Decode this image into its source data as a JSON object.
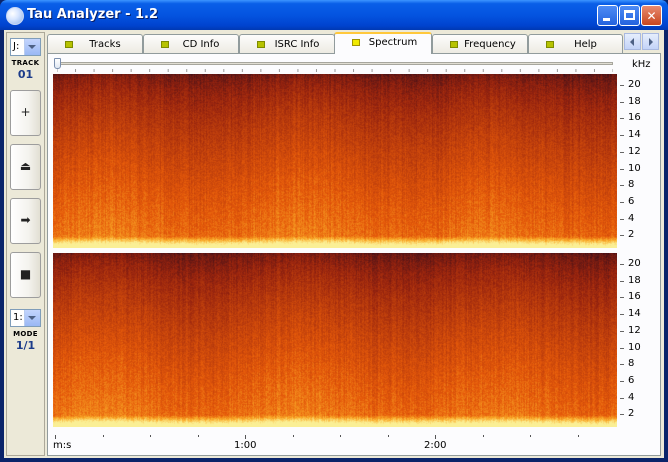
{
  "window": {
    "title": "Tau Analyzer - 1.2",
    "accent": "#0454e0"
  },
  "sidebar": {
    "drive_select": "J:",
    "track_label": "TRACK",
    "track_value": "01",
    "buttons": [
      {
        "icon": "plus-icon",
        "glyph": "+"
      },
      {
        "icon": "eject-icon",
        "glyph": "⏏"
      },
      {
        "icon": "play-arrow-icon",
        "glyph": "➡"
      },
      {
        "icon": "stop-icon",
        "glyph": "■"
      }
    ],
    "mode_select": "1:",
    "mode_label": "MODE",
    "mode_value": "1/1"
  },
  "tabs": [
    {
      "label": "Tracks",
      "active": false
    },
    {
      "label": "CD Info",
      "active": false
    },
    {
      "label": "ISRC Info",
      "active": false
    },
    {
      "label": "Spectrum",
      "active": true
    },
    {
      "label": "Frequency",
      "active": false
    },
    {
      "label": "Help",
      "active": false
    }
  ],
  "spectrum": {
    "unit": "kHz",
    "y_ticks": [
      "20",
      "18",
      "16",
      "14",
      "12",
      "10",
      "8",
      "6",
      "4",
      "2"
    ],
    "x_axis_label": "m:s",
    "x_ticks": [
      "1:00",
      "2:00"
    ],
    "colors": {
      "low": "#e05a0a",
      "high": "#3a0f18",
      "floor": "#ffd35a"
    }
  }
}
